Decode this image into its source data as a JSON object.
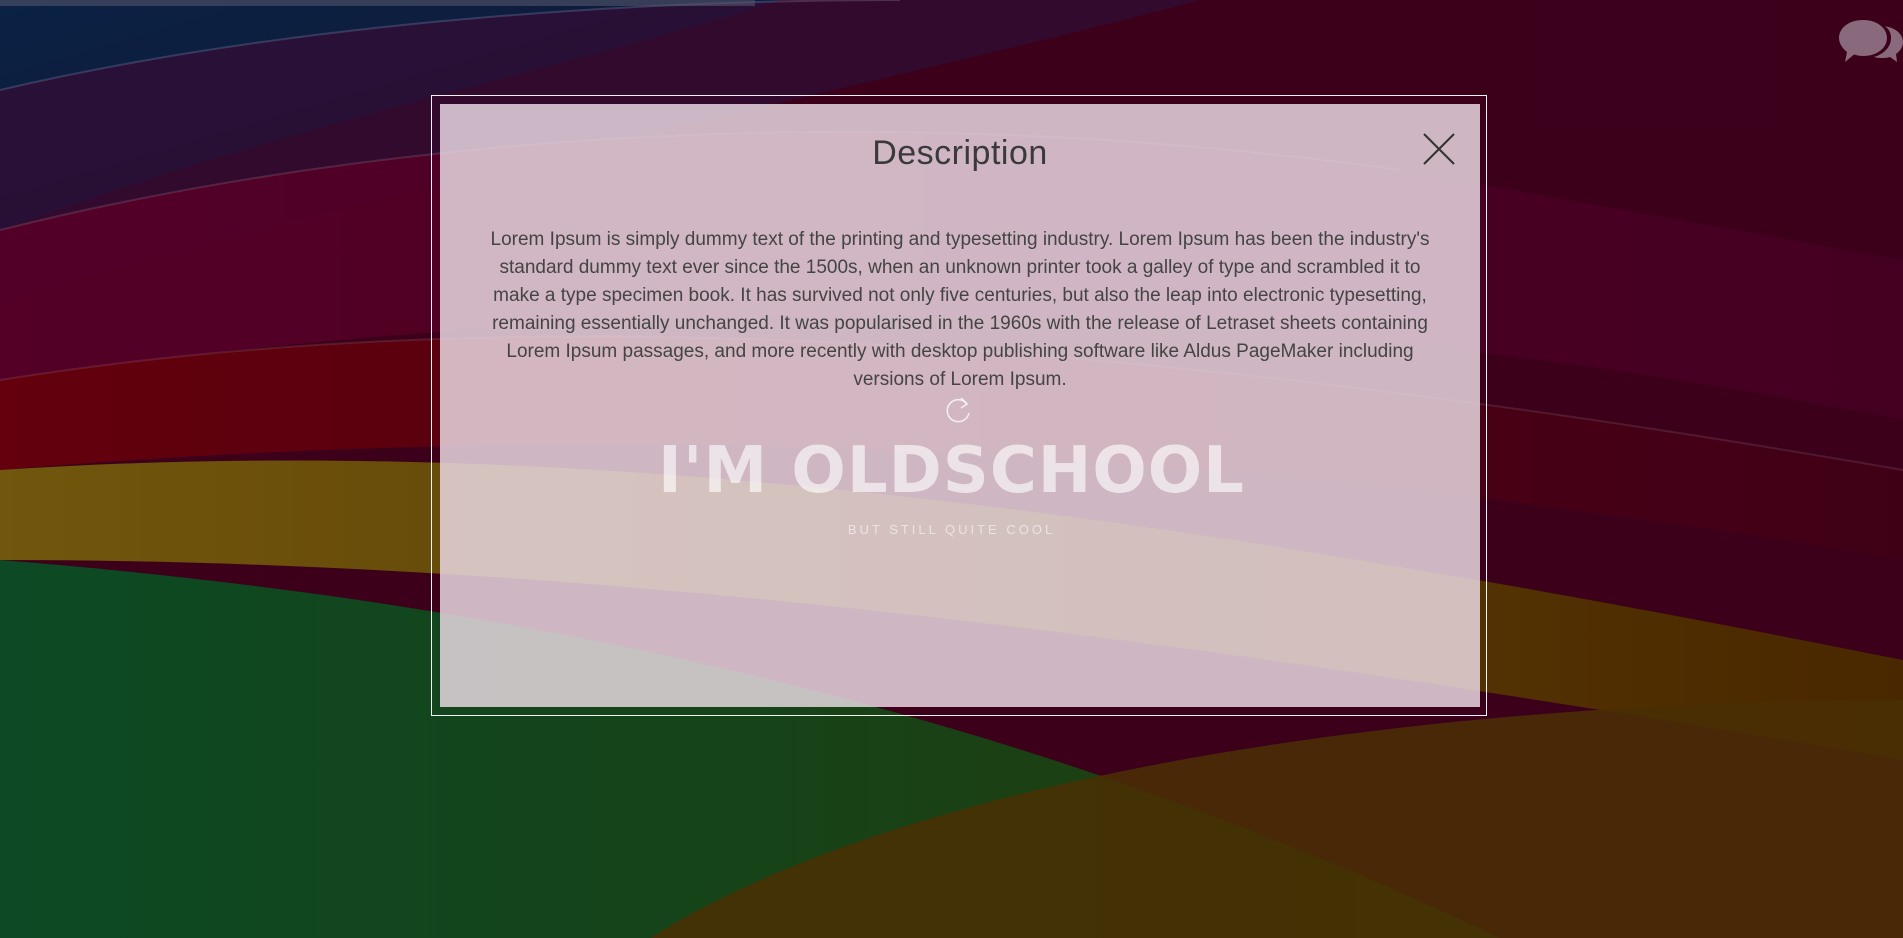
{
  "colors": {
    "modal_background": "#eedee8",
    "modal_border": "#ffffff",
    "title_text": "#3a3a3a",
    "body_text": "#444444",
    "background_primary": "#4a0022"
  },
  "modal": {
    "title": "Description",
    "close_icon": "close-icon",
    "body": "Lorem Ipsum is simply dummy text of the printing and typesetting industry. Lorem Ipsum has been the industry's standard dummy text ever since the 1500s, when an unknown printer took a galley of type and scrambled it to make a type specimen book. It has survived not only five centuries, but also the leap into electronic typesetting, remaining essentially unchanged. It was popularised in the 1960s with the release of Letraset sheets containing Lorem Ipsum passages, and more recently with desktop publishing software like Aldus PageMaker including versions of Lorem Ipsum."
  },
  "hero": {
    "title": "I'M OLDSCHOOL",
    "subtitle": "BUT STILL QUITE COOL",
    "reload_icon": "reload-icon"
  },
  "chat": {
    "icon": "chat-bubbles-icon"
  }
}
